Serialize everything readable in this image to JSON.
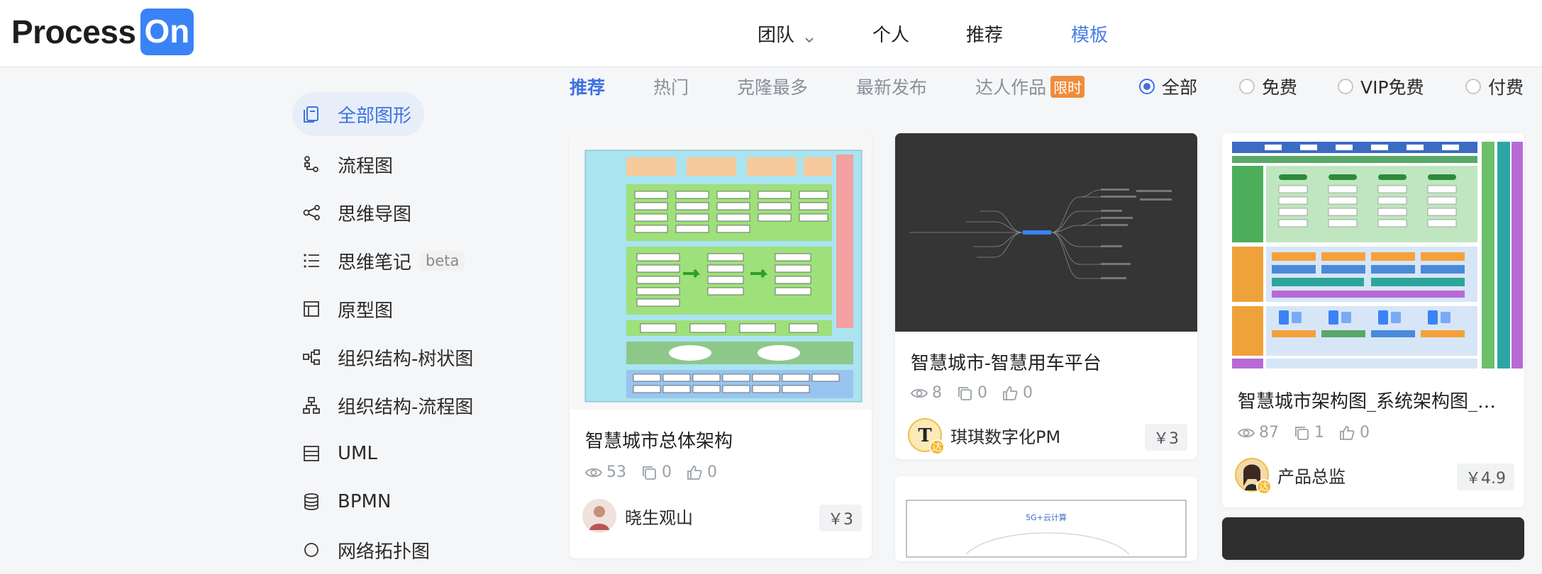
{
  "app": {
    "logo_text": "Process",
    "logo_badge": "On"
  },
  "nav": {
    "team": "团队",
    "personal": "个人",
    "recommend": "推荐",
    "templates": "模板"
  },
  "sidebar": {
    "items": [
      {
        "label": "全部图形",
        "icon": "all-shapes-icon"
      },
      {
        "label": "流程图",
        "icon": "flowchart-icon"
      },
      {
        "label": "思维导图",
        "icon": "mindmap-icon"
      },
      {
        "label": "思维笔记",
        "icon": "list-icon",
        "badge": "beta"
      },
      {
        "label": "原型图",
        "icon": "prototype-icon"
      },
      {
        "label": "组织结构-树状图",
        "icon": "tree-icon"
      },
      {
        "label": "组织结构-流程图",
        "icon": "org-flow-icon"
      },
      {
        "label": "UML",
        "icon": "uml-icon"
      },
      {
        "label": "BPMN",
        "icon": "database-icon"
      },
      {
        "label": "网络拓扑图",
        "icon": "network-icon"
      }
    ]
  },
  "filters": {
    "tabs": [
      "推荐",
      "热门",
      "克隆最多",
      "最新发布",
      "达人作品"
    ],
    "limit_badge": "限时",
    "radios": [
      "全部",
      "免费",
      "VIP免费",
      "付费"
    ]
  },
  "cards": [
    {
      "title": "智慧城市总体架构",
      "views": "53",
      "clones": "0",
      "likes": "0",
      "author": "晓生观山",
      "price": "￥3"
    },
    {
      "title": "智慧城市-智慧用车平台",
      "views": "8",
      "clones": "0",
      "likes": "0",
      "author": "琪琪数字化PM",
      "price": "￥3",
      "author_badge": "达"
    },
    {
      "title": "智慧城市架构图_系统架构图_…",
      "views": "87",
      "clones": "1",
      "likes": "0",
      "author": "产品总监",
      "price": "￥4.9",
      "author_badge": "达"
    },
    {
      "thumb_text": "5G+云计算"
    }
  ],
  "colors": {
    "accent": "#3d72e0",
    "logo_blue": "#3b82f6",
    "limit_orange": "#f08c3c"
  }
}
